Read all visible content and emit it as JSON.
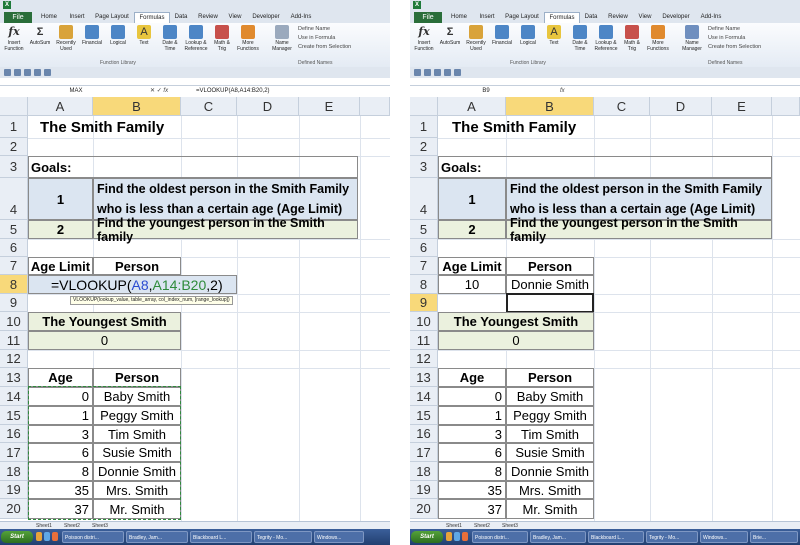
{
  "ribbon": {
    "tabs": [
      "Home",
      "Insert",
      "Page Layout",
      "Formulas",
      "Data",
      "Review",
      "View",
      "Developer",
      "Add-Ins"
    ],
    "file_tab": "File",
    "buttons": [
      {
        "label": "Insert Function",
        "icon": "fx-icon"
      },
      {
        "label": "AutoSum",
        "icon": "sigma-icon"
      },
      {
        "label": "Recently Used",
        "icon": "book-icon"
      },
      {
        "label": "Financial",
        "icon": "book-icon"
      },
      {
        "label": "Logical",
        "icon": "book-icon"
      },
      {
        "label": "Text",
        "icon": "book-icon"
      },
      {
        "label": "Date & Time",
        "icon": "book-icon"
      },
      {
        "label": "Lookup & Reference",
        "icon": "book-icon"
      },
      {
        "label": "Math & Trig",
        "icon": "book-icon"
      },
      {
        "label": "More Functions",
        "icon": "book-icon"
      },
      {
        "label": "Name Manager",
        "icon": "tag-icon"
      }
    ],
    "group_function_library": "Function Library",
    "group_defined_names": "Defined Names",
    "defined_names_items": [
      "Define Name",
      "Use in Formula",
      "Create from Selection"
    ]
  },
  "panes": [
    {
      "namebox": "MAX",
      "formula": "=VLOOKUP(A8,A14:B20,2)",
      "selected_col": "B",
      "selected_row": "8",
      "row8": {
        "formula_display": "=VLOOKUP(A8,A14:B20,2)",
        "formula_prefix": "=VLOOKUP(",
        "ref1": "A8",
        "comma1": ",",
        "ref2": "A14:B20",
        "suffix": ",2)"
      },
      "tooltip": "VLOOKUP(lookup_value, table_array, col_index_num, [range_lookup])",
      "sheet_tabs": [
        "Sheet1",
        "Sheet2",
        "Sheet3"
      ]
    },
    {
      "namebox": "B9",
      "formula": "",
      "selected_col": "B",
      "selected_row": "9",
      "row8": {
        "age_limit": "10",
        "person": "Donnie Smith"
      },
      "sheet_tabs": [
        "Sheet1",
        "Sheet2",
        "Sheet3"
      ]
    }
  ],
  "columns": [
    "A",
    "B",
    "C",
    "D",
    "E"
  ],
  "rows": [
    "1",
    "2",
    "3",
    "4",
    "5",
    "6",
    "7",
    "8",
    "9",
    "10",
    "11",
    "12",
    "13",
    "14",
    "15",
    "16",
    "17",
    "18",
    "19",
    "20"
  ],
  "sheet": {
    "title": "The Smith Family",
    "goals_label": "Goals:",
    "goal1_num": "1",
    "goal1_text_line1": "Find the oldest person in the Smith Family",
    "goal1_text_line2": "who is less than a certain age (Age Limit)",
    "goal2_num": "2",
    "goal2_text": "Find the youngest person in the Smith family",
    "age_limit_header": "Age Limit",
    "person_header": "Person",
    "youngest_header": "The Youngest Smith",
    "youngest_value": "0",
    "age_header": "Age",
    "person_header2": "Person",
    "table": [
      {
        "age": "0",
        "person": "Baby Smith"
      },
      {
        "age": "1",
        "person": "Peggy Smith"
      },
      {
        "age": "3",
        "person": "Tim Smith"
      },
      {
        "age": "6",
        "person": "Susie Smith"
      },
      {
        "age": "8",
        "person": "Donnie Smith"
      },
      {
        "age": "35",
        "person": "Mrs. Smith"
      },
      {
        "age": "37",
        "person": "Mr. Smith"
      }
    ]
  },
  "taskbar": {
    "start": "Start",
    "items_left": [
      "Poisson distri...",
      "Bradley, Jam...",
      "Blackboard L...",
      "Tegrity - Mo...",
      "Windows..."
    ],
    "items_right": [
      "Poisson distri...",
      "Bradley, Jam...",
      "Blackboard L...",
      "Tegrity - Mo...",
      "Windows...",
      "Brie..."
    ]
  },
  "colors": {
    "blue_fill": "#dbe5f1",
    "green_fill": "#ebf1de",
    "selected_header": "#f8d97a",
    "ref_blue": "#2a4bd1",
    "ref_green": "#2e8b3a"
  }
}
